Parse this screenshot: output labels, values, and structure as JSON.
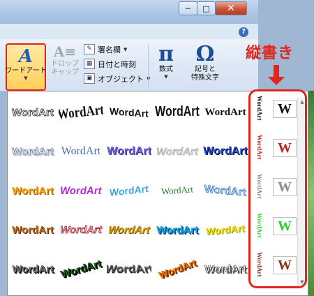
{
  "window": {
    "minimize_glyph": "─",
    "restore_glyph": "□",
    "close_glyph": "✕",
    "help_glyph": "?"
  },
  "ribbon": {
    "wordart": {
      "icon_glyph": "A",
      "label": "ワードアート",
      "arrow": "▼"
    },
    "dropcap": {
      "icon_glyph": "A≡",
      "label_line1": "ドロップ",
      "label_line2": "キャップ"
    },
    "small_items": [
      {
        "icon_glyph": "✎",
        "label": "署名欄",
        "has_dropdown": true
      },
      {
        "icon_glyph": "▦",
        "label": "日付と時刻",
        "has_dropdown": false
      },
      {
        "icon_glyph": "▣",
        "label": "オブジェクト",
        "has_dropdown": true
      }
    ],
    "equation": {
      "icon_glyph": "π",
      "label": "数式"
    },
    "symbol": {
      "icon_glyph": "Ω",
      "label_line1": "記号と",
      "label_line2": "特殊文字"
    }
  },
  "annotation": {
    "label": "縦書き",
    "color": "#e0261c"
  },
  "gallery": {
    "wordart_text": "WordArt",
    "rows": [
      [
        {
          "style": "plain-outline",
          "color": "#ffffff",
          "stroke": "#222222"
        },
        {
          "style": "arch-black",
          "color": "#111111"
        },
        {
          "style": "wave-black",
          "color": "#111111"
        },
        {
          "style": "bold-black",
          "color": "#111111"
        },
        {
          "style": "serif-black",
          "color": "#111111"
        }
      ],
      [
        {
          "style": "outline-shadow",
          "color": "#ffffff",
          "stroke": "#6b7f99"
        },
        {
          "style": "serif-blue",
          "color": "#3f6fb0"
        },
        {
          "style": "purple-gradient",
          "color": "#6b5fd0"
        },
        {
          "style": "silver",
          "color": "#dddddd",
          "stroke": "#999999"
        },
        {
          "style": "blue-bevel",
          "color": "#1f3fd0"
        }
      ],
      [
        {
          "style": "orange-gradient",
          "color": "#f5a500"
        },
        {
          "style": "magenta-gradient",
          "color": "#b02fd0"
        },
        {
          "style": "rainbow-wave",
          "color": "#40a8e0"
        },
        {
          "style": "green-serif-arch",
          "color": "#2f7f2f"
        },
        {
          "style": "blue-wave-outline",
          "color": "#cfe4ff",
          "stroke": "#3a78c0"
        }
      ],
      [
        {
          "style": "bronze",
          "color": "#b8651c"
        },
        {
          "style": "rose-outline",
          "color": "#f6c0c0",
          "stroke": "#a01f2f"
        },
        {
          "style": "gold-slant",
          "color": "#d69a00"
        },
        {
          "style": "cyan-3d",
          "color": "#1fa8e0"
        },
        {
          "style": "yellow-wave",
          "color": "#f0e000"
        }
      ],
      [
        {
          "style": "gray-3d",
          "color": "#7a7a7a"
        },
        {
          "style": "green-slant-3d",
          "color": "#1d5f1d"
        },
        {
          "style": "gray-perspective",
          "color": "#555555"
        },
        {
          "style": "orange-3d",
          "color": "#f08000"
        },
        {
          "style": "white-deep-3d",
          "color": "#ffffff",
          "stroke": "#333333"
        }
      ]
    ],
    "vertical_column": [
      {
        "style": "vertical-black",
        "color": "#111111",
        "preview_glyph": "W"
      },
      {
        "style": "vertical-red-slant",
        "color": "#c0241c",
        "preview_glyph": "W"
      },
      {
        "style": "vertical-gray-serif",
        "color": "#8a8a8a",
        "preview_glyph": "W"
      },
      {
        "style": "vertical-green-blue",
        "color": "#2fd02f",
        "preview_glyph": "W"
      },
      {
        "style": "vertical-brown-3d",
        "color": "#8a3a1a",
        "preview_glyph": "W"
      }
    ],
    "scroll_up": "▲",
    "scroll_down": "▼"
  }
}
